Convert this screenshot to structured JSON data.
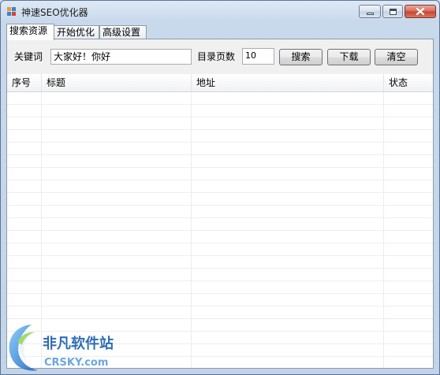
{
  "window": {
    "title": "神速SEO优化器",
    "controls": {
      "minimize": "minimize-icon",
      "maximize": "maximize-icon",
      "close_glyph": "x"
    }
  },
  "tabs": [
    {
      "label": "搜索资源",
      "active": true
    },
    {
      "label": "开始优化",
      "active": false
    },
    {
      "label": "高级设置",
      "active": false
    }
  ],
  "search": {
    "keyword_label": "关键词",
    "keyword_value": "大家好！你好",
    "pages_label": "目录页数",
    "pages_value": "10",
    "search_button": "搜索",
    "download_button": "下载",
    "clear_button": "清空"
  },
  "table": {
    "columns": [
      "序号",
      "标题",
      "地址",
      "状态"
    ],
    "rows": []
  },
  "watermark": {
    "brand": "非凡软件站",
    "domain": "CRSKY.com"
  },
  "colors": {
    "accent_blue": "#2f6db6",
    "close_red": "#c54431"
  }
}
